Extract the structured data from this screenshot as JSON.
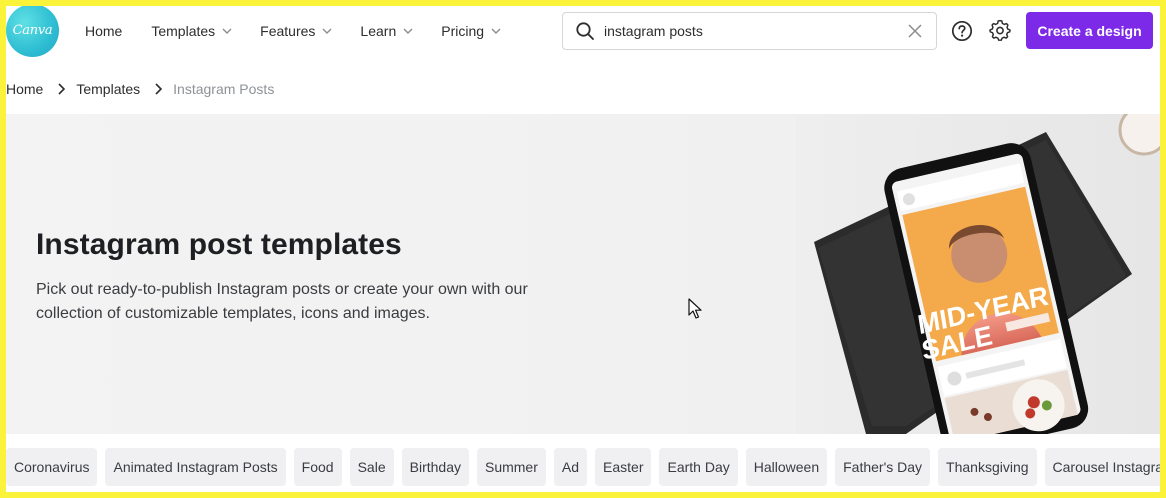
{
  "logo": {
    "text": "Canva"
  },
  "nav": {
    "items": [
      {
        "label": "Home",
        "has_dropdown": false
      },
      {
        "label": "Templates",
        "has_dropdown": true
      },
      {
        "label": "Features",
        "has_dropdown": true
      },
      {
        "label": "Learn",
        "has_dropdown": true
      },
      {
        "label": "Pricing",
        "has_dropdown": true
      }
    ]
  },
  "search": {
    "value": "instagram posts",
    "icon": "search-icon",
    "clear_icon": "close-icon"
  },
  "header_icons": {
    "help": "help-icon",
    "settings": "gear-icon"
  },
  "create_button": {
    "label": "Create a design",
    "color": "#7d2ae8"
  },
  "breadcrumb": {
    "items": [
      "Home",
      "Templates",
      "Instagram Posts"
    ]
  },
  "hero": {
    "title": "Instagram post templates",
    "description_line1": "Pick out ready-to-publish Instagram posts or create your own with our",
    "description_line2": "collection of customizable templates, icons and images.",
    "phone_ad": {
      "line1": "MID-YEAR",
      "line2": "SALE"
    }
  },
  "chips": [
    "Coronavirus",
    "Animated Instagram Posts",
    "Food",
    "Sale",
    "Birthday",
    "Summer",
    "Ad",
    "Easter",
    "Earth Day",
    "Halloween",
    "Father's Day",
    "Thanksgiving",
    "Carousel Instagram Posts"
  ],
  "colors": {
    "frame_border": "#fbf23a",
    "accent": "#7d2ae8",
    "logo": "#31c0d4"
  }
}
